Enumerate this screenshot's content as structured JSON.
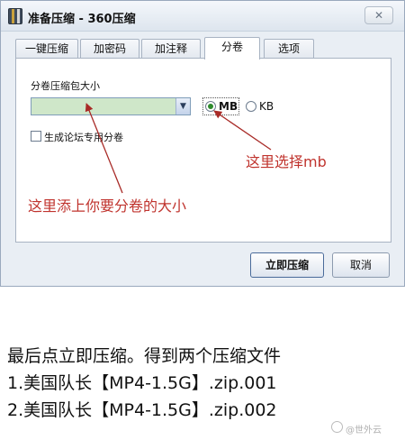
{
  "window": {
    "title": "准备压缩 - 360压缩",
    "close_label": "✕"
  },
  "tabs": [
    {
      "label": "一键压缩",
      "active": false
    },
    {
      "label": "加密码",
      "active": false
    },
    {
      "label": "加注释",
      "active": false
    },
    {
      "label": "分卷",
      "active": true
    },
    {
      "label": "选项",
      "active": false
    }
  ],
  "split": {
    "size_label": "分卷压缩包大小",
    "size_value": "",
    "unit_mb": "MB",
    "unit_kb": "KB",
    "selected_unit": "MB",
    "forum_checkbox_label": "生成论坛专用分卷",
    "forum_checked": false
  },
  "annotations": {
    "select_mb": "这里选择mb",
    "fill_size": "这里添上你要分卷的大小",
    "color": "#c0342e"
  },
  "buttons": {
    "compress": "立即压缩",
    "cancel": "取消"
  },
  "article": {
    "lines": [
      "最后点立即压缩。得到两个压缩文件",
      "1.美国队长【MP4-1.5G】.zip.001",
      "2.美国队长【MP4-1.5G】.zip.002"
    ]
  },
  "watermark": "@世外云"
}
